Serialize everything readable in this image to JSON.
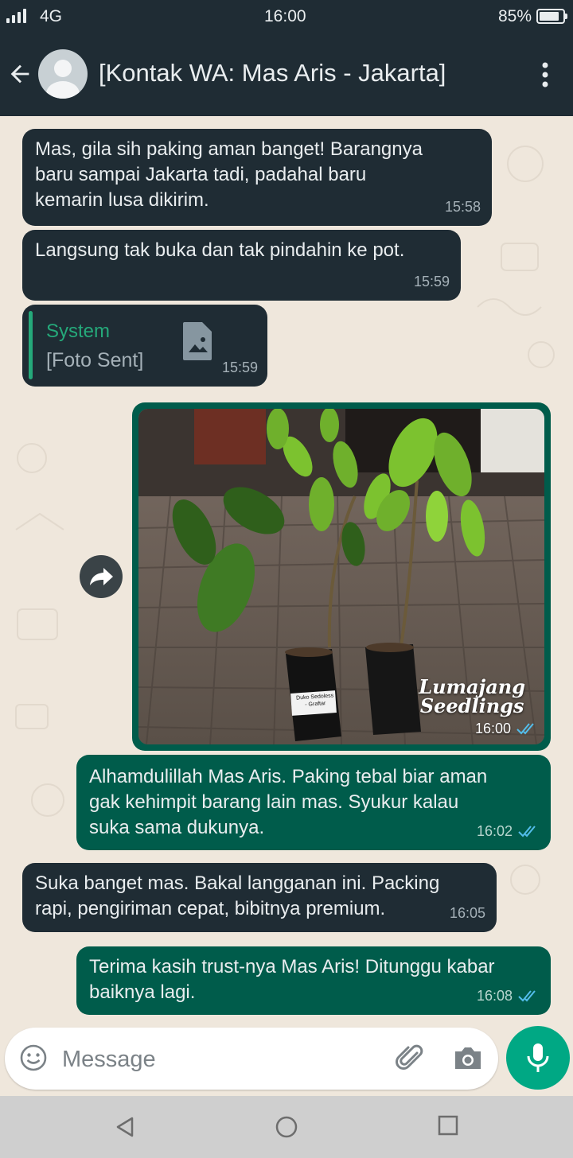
{
  "status_bar": {
    "network": "4G",
    "time": "16:00",
    "battery": "85%",
    "battery_level": 0.85,
    "signal_bars": 4
  },
  "header": {
    "contact_name": "[Kontak WA: Mas Aris - Jakarta]",
    "avatar_icon": "person-icon",
    "menu_icon": "more-vert-icon",
    "back_icon": "arrow-back-icon"
  },
  "messages": [
    {
      "direction": "incoming",
      "text": "Mas, gila sih paking aman banget! Barangnya\nbaru sampai Jakarta tadi, padahal baru\nkemarin lusa dikirim.",
      "time": "15:58"
    },
    {
      "direction": "incoming",
      "text": "Langsung tak buka dan tak pindahin ke pot.",
      "time": "15:59"
    },
    {
      "direction": "incoming",
      "type": "reply-system",
      "sender": "System",
      "text": "[Foto Sent]",
      "time": "15:59",
      "icon": "photo-icon"
    },
    {
      "direction": "outgoing",
      "type": "image",
      "watermark_line1": "Lumajang",
      "watermark_line2": "Seedlings",
      "pot_label_line1": "Duko Sedoless",
      "pot_label_line2": "- Graftar",
      "time": "16:00",
      "status": "read"
    },
    {
      "direction": "outgoing",
      "text": "Alhamdulillah Mas Aris. Paking tebal biar aman\ngak kehimpit barang lain mas. Syukur kalau\nsuka sama dukunya.",
      "time": "16:02",
      "status": "read"
    },
    {
      "direction": "incoming",
      "text": "Suka banget mas. Bakal langganan ini. Packing\nrapi, pengiriman cepat, bibitnya premium.",
      "time": "16:05"
    },
    {
      "direction": "outgoing",
      "text": "Terima kasih trust-nya Mas Aris! Ditunggu kabar\nbaiknya lagi.",
      "time": "16:08",
      "status": "read"
    }
  ],
  "input_bar": {
    "placeholder": "Message",
    "emoji_icon": "emoji-icon",
    "attach_icon": "paperclip-icon",
    "camera_icon": "camera-icon",
    "mic_icon": "mic-icon"
  },
  "nav_bar": {
    "back_icon": "nav-back-icon",
    "home_icon": "nav-home-icon",
    "recents_icon": "nav-recents-icon"
  },
  "colors": {
    "header": "#1f2c34",
    "incoming": "#1f2c34",
    "outgoing": "#005c4b",
    "accent": "#25a97a",
    "mic_button": "#00a884",
    "read_tick": "#53bdeb",
    "wallpaper": "#efe7dc"
  }
}
